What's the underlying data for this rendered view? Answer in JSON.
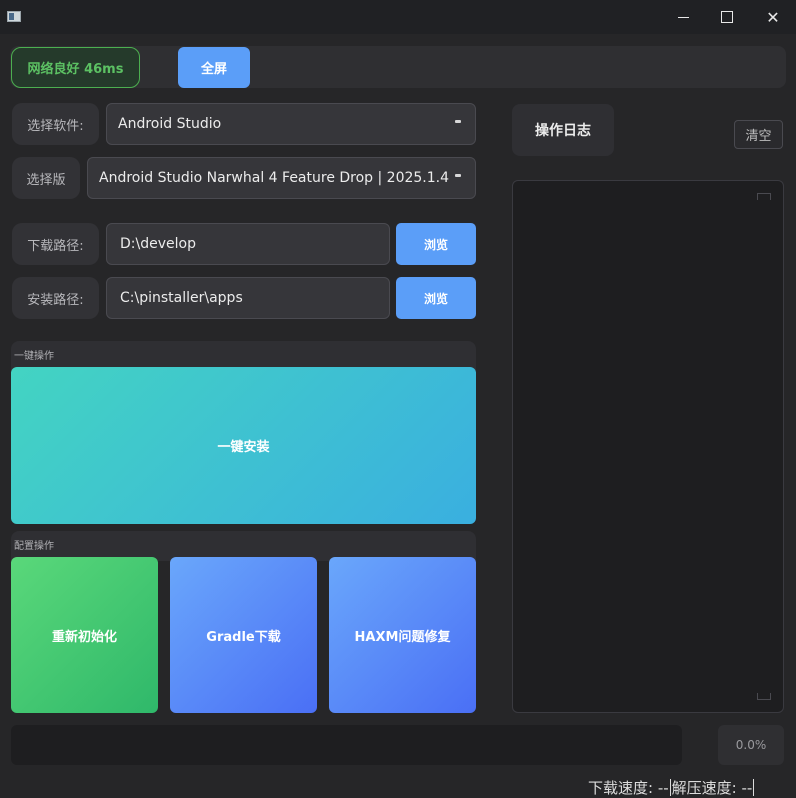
{
  "titlebar": {
    "icons": [
      "app-icon",
      "minimize-icon",
      "maximize-icon",
      "close-icon"
    ],
    "close_glyph": "✕"
  },
  "topbar": {
    "network_status": "网络良好 46ms",
    "fullscreen_label": "全屏"
  },
  "form": {
    "software_label": "选择软件:",
    "software_value": "Android Studio",
    "version_label": "选择版",
    "version_value": "Android Studio Narwhal 4 Feature Drop | 2025.1.4",
    "download_label": "下载路径:",
    "download_value": "D:\\develop",
    "install_label": "安装路径:",
    "install_value": "C:\\pinstaller\\apps",
    "browse_label": "浏览"
  },
  "one_click": {
    "section_title": "一键操作",
    "install_label": "一键安装"
  },
  "config": {
    "section_title": "配置操作",
    "buttons": [
      "重新初始化",
      "Gradle下载",
      "HAXM问题修复"
    ]
  },
  "log": {
    "title": "操作日志",
    "clear_label": "清空"
  },
  "progress": {
    "value": 0.0,
    "label": "0.0%"
  },
  "status": {
    "download_speed": "下载速度: --",
    "extract_speed": "解压速度: --"
  },
  "colors": {
    "accent": "#5b9ef8",
    "network_ok": "#5cc163",
    "background": "#262628"
  }
}
